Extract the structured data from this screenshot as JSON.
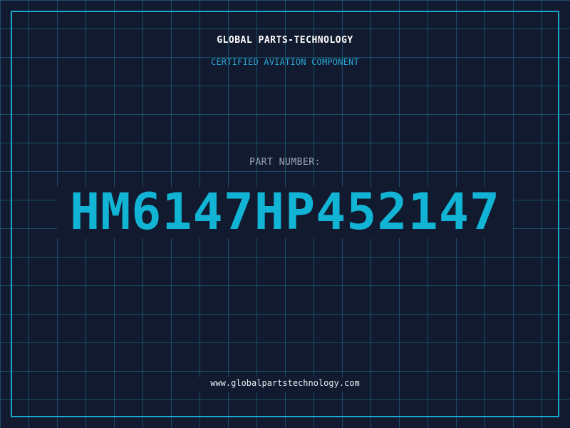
{
  "header": {
    "company": "GLOBAL PARTS-TECHNOLOGY",
    "subtitle": "CERTIFIED AVIATION COMPONENT"
  },
  "part": {
    "label": "PART NUMBER:",
    "number": "HM6147HP452147"
  },
  "footer": {
    "url": "www.globalpartstechnology.com"
  },
  "colors": {
    "background": "#111a2e",
    "grid": "#1e7896",
    "frame": "#1aa9cc",
    "accent": "#12b4d6",
    "subtitle": "#2aa7d6",
    "label": "#9aa6b8",
    "text": "#ffffff"
  }
}
